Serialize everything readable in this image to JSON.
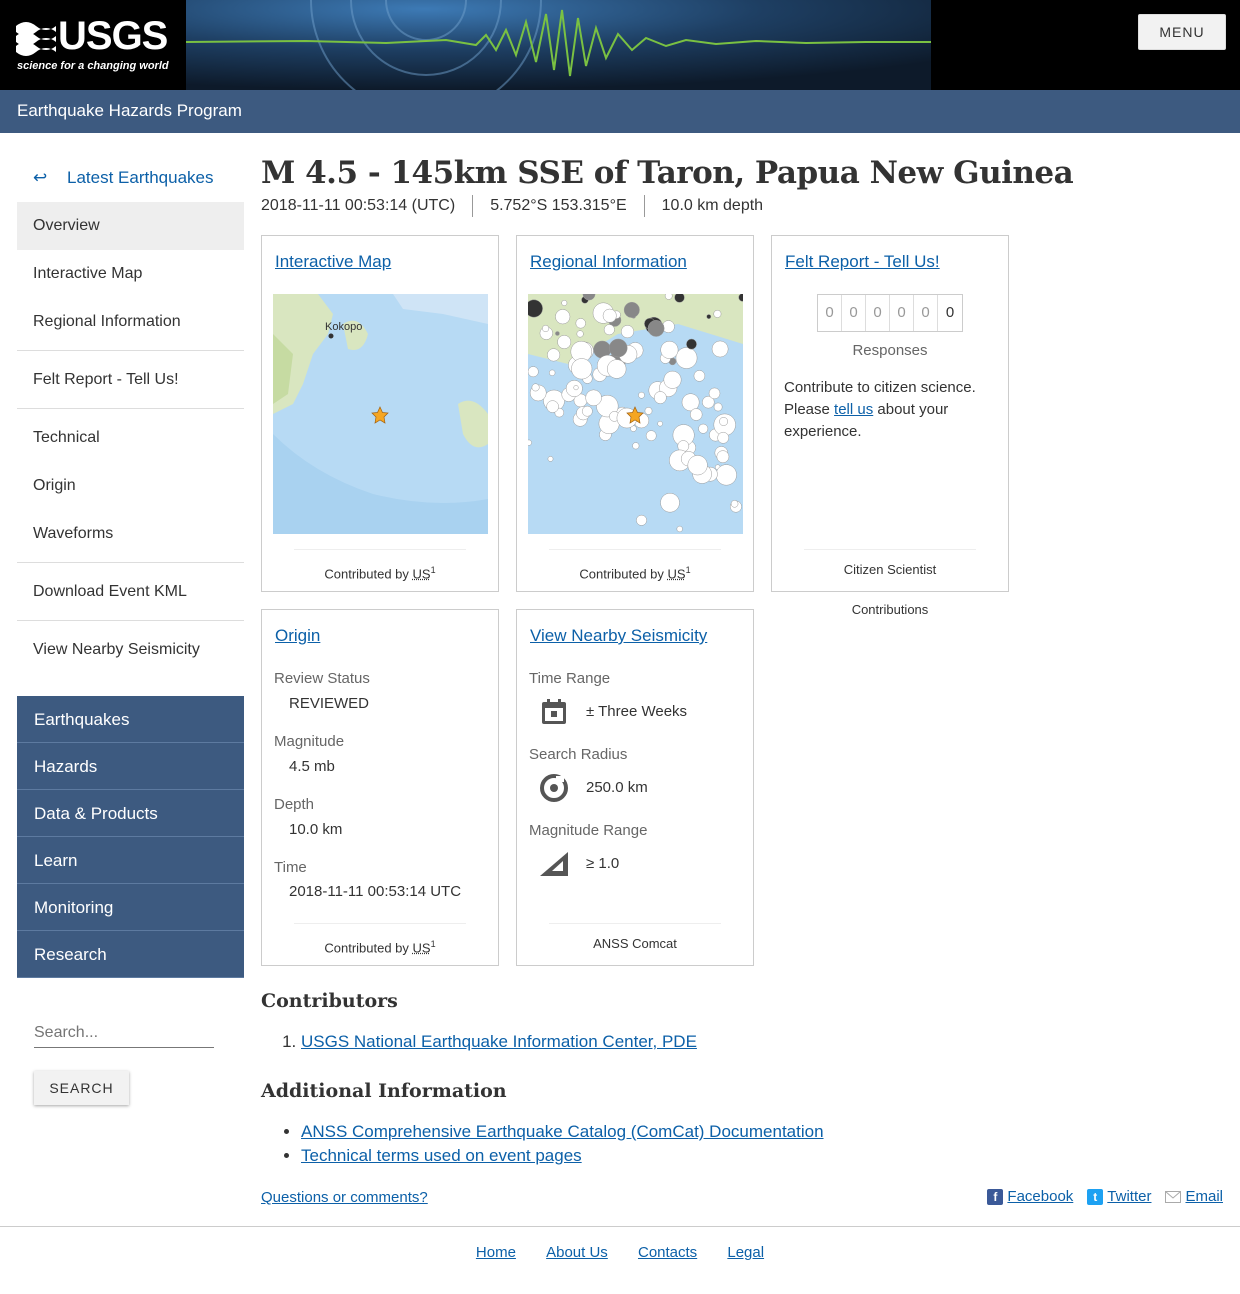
{
  "header": {
    "logo_text": "USGS",
    "logo_tagline": "science for a changing world",
    "menu_label": "MENU",
    "program": "Earthquake Hazards Program"
  },
  "nav": {
    "back_arrow": "↩",
    "back_label": "Latest Earthquakes",
    "items": [
      {
        "label": "Overview",
        "active": true
      },
      {
        "label": "Interactive Map"
      },
      {
        "label": "Regional Information"
      },
      {
        "label": "Felt Report - Tell Us!"
      },
      {
        "label": "Technical"
      },
      {
        "label": "Origin"
      },
      {
        "label": "Waveforms"
      },
      {
        "label": "Download Event KML"
      },
      {
        "label": "View Nearby Seismicity"
      }
    ],
    "sections": [
      "Earthquakes",
      "Hazards",
      "Data & Products",
      "Learn",
      "Monitoring",
      "Research"
    ],
    "search_placeholder": "Search...",
    "search_button": "SEARCH"
  },
  "event": {
    "title": "M 4.5 - 145km SSE of Taron, Papua New Guinea",
    "time": "2018-11-11 00:53:14 (UTC)",
    "location": "5.752°S 153.315°E",
    "depth": "10.0 km depth"
  },
  "cards": {
    "map": {
      "title": "Interactive Map",
      "place_label": "Kokopo",
      "contrib_prefix": "Contributed by",
      "contrib_id": "US",
      "contrib_num": "1"
    },
    "regional": {
      "title": "Regional Information",
      "contrib_prefix": "Contributed by",
      "contrib_id": "US",
      "contrib_num": "1"
    },
    "felt": {
      "title": "Felt Report - Tell Us!",
      "digits": [
        "0",
        "0",
        "0",
        "0",
        "0",
        "0"
      ],
      "responses_label": "Responses",
      "text_before": "Contribute to citizen science. Please ",
      "link": "tell us",
      "text_after": " about your experience.",
      "footer": "Citizen Scientist Contributions"
    },
    "origin": {
      "title": "Origin",
      "review_label": "Review Status",
      "review_value": "REVIEWED",
      "magnitude_label": "Magnitude",
      "magnitude_value": "4.5 mb",
      "depth_label": "Depth",
      "depth_value": "10.0 km",
      "time_label": "Time",
      "time_value": "2018-11-11 00:53:14 UTC",
      "contrib_prefix": "Contributed by",
      "contrib_id": "US",
      "contrib_num": "1"
    },
    "nearby": {
      "title": "View Nearby Seismicity",
      "time_range_label": "Time Range",
      "time_range_value": "± Three Weeks",
      "radius_label": "Search Radius",
      "radius_value": "250.0 km",
      "mag_range_label": "Magnitude Range",
      "mag_range_value": "≥ 1.0",
      "footer": "ANSS Comcat"
    }
  },
  "contributors": {
    "heading": "Contributors",
    "items": [
      "USGS National Earthquake Information Center, PDE"
    ]
  },
  "additional": {
    "heading": "Additional Information",
    "items": [
      "ANSS Comprehensive Earthquake Catalog (ComCat) Documentation",
      "Technical terms used on event pages"
    ]
  },
  "share": {
    "questions": "Questions or comments?",
    "facebook": "Facebook",
    "twitter": "Twitter",
    "email": "Email"
  },
  "footer": [
    "Home",
    "About Us",
    "Contacts",
    "Legal"
  ],
  "colors": {
    "nav_blue": "#3d5a80",
    "link": "#0c60a8",
    "seismo_green": "#7ac142"
  }
}
